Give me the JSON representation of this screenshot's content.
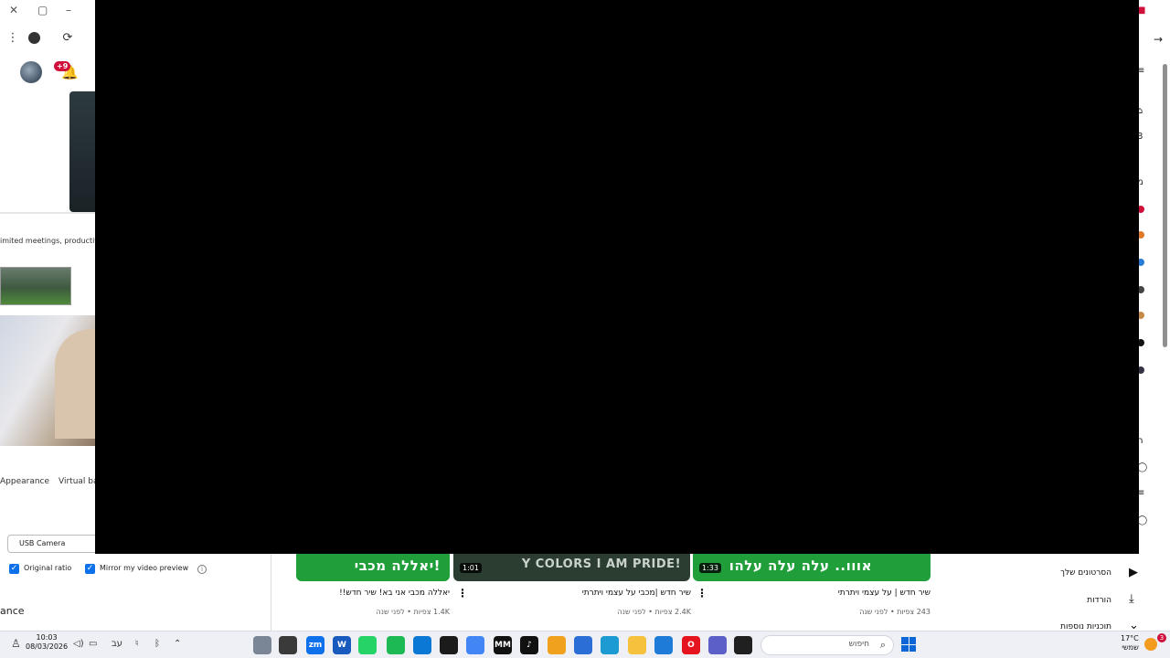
{
  "zoom": {
    "bell_badge": "+9",
    "promo_text": "imited meetings, productivity",
    "tabs": {
      "appearance": "Appearance",
      "virtual": "Virtual ba"
    },
    "camera_select": "USB Camera",
    "original_ratio": "Original ratio",
    "mirror_preview": "Mirror my video preview",
    "section_label": "ance"
  },
  "youtube": {
    "videos": [
      {
        "thumb_title": "יאללה מכבי!",
        "title": "יאללה מכבי אני בא! שיר חדש!!",
        "meta": "1.4K צפיות • לפני שנה",
        "duration": "",
        "color": "#1f9e3a"
      },
      {
        "thumb_title": "Y COLORS I AM PRIDE!",
        "title": "שיר חדש |מכבי על עצמי ויתרתי",
        "meta": "2.4K צפיות • לפני שנה",
        "duration": "1:01",
        "color": "#2a3d30"
      },
      {
        "thumb_title": "אווו.. עלה עלה עלהו",
        "title": "שיר חדש | על עצמי ויתרתי",
        "meta": "243 צפיות • לפני שנה",
        "duration": "1:33",
        "color": "#1f9e3a"
      }
    ],
    "sidebar": [
      {
        "label": "הסרטונים שלך",
        "icon": "video-library-icon"
      },
      {
        "label": "הורדות",
        "icon": "download-icon"
      },
      {
        "label": "תוכניות נוספות",
        "icon": "chevron-down-icon"
      }
    ],
    "edge_glyphs": [
      "ה",
      "מ"
    ]
  },
  "taskbar": {
    "time": "10:03",
    "date": "08/03/2026",
    "lang": "עב",
    "search_placeholder": "חיפוש",
    "weather_temp": "17°C",
    "weather_desc": "שמשי",
    "notification_count": "3",
    "apps": [
      {
        "name": "camera-app",
        "label": "",
        "color": "#7a8595"
      },
      {
        "name": "obs-app",
        "label": "",
        "color": "#3a3a3a"
      },
      {
        "name": "zoom-app",
        "label": "zm",
        "color": "#0e71eb"
      },
      {
        "name": "word-app",
        "label": "W",
        "color": "#185abd"
      },
      {
        "name": "whatsapp-app",
        "label": "",
        "color": "#25d366"
      },
      {
        "name": "spotify-app",
        "label": "",
        "color": "#1db954"
      },
      {
        "name": "onedrive-app",
        "label": "",
        "color": "#0a78d4"
      },
      {
        "name": "waveform-app",
        "label": "",
        "color": "#1b1b1b"
      },
      {
        "name": "chrome-app",
        "label": "",
        "color": "#4285f4"
      },
      {
        "name": "mm-app",
        "label": "MM",
        "color": "#111111"
      },
      {
        "name": "tiktok-app",
        "label": "♪",
        "color": "#111111"
      },
      {
        "name": "paint-app",
        "label": "",
        "color": "#f0a11e"
      },
      {
        "name": "store-app",
        "label": "",
        "color": "#2b6fd6"
      },
      {
        "name": "edge-app",
        "label": "",
        "color": "#1b9bd1"
      },
      {
        "name": "files-app",
        "label": "",
        "color": "#f6c23e"
      },
      {
        "name": "media-app",
        "label": "",
        "color": "#1f7bd8"
      },
      {
        "name": "opera-app",
        "label": "O",
        "color": "#e5141e"
      },
      {
        "name": "teams-app",
        "label": "",
        "color": "#5b5fc7"
      },
      {
        "name": "terminal-app",
        "label": "",
        "color": "#202020"
      }
    ]
  }
}
